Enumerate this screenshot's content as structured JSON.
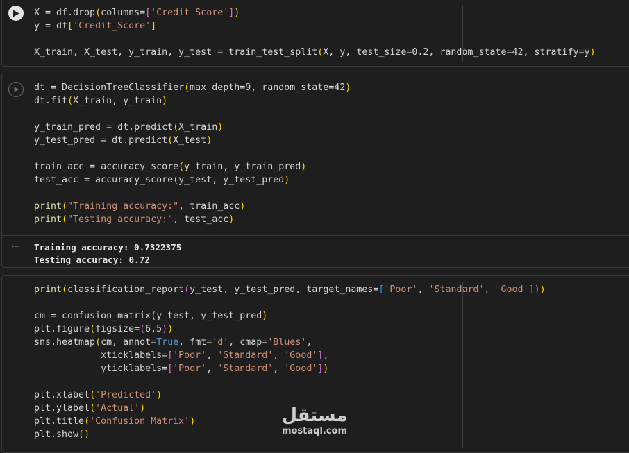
{
  "cells": [
    {
      "id": "cell1",
      "run_state": "active",
      "lines": [
        [
          {
            "t": "X = df.drop"
          },
          {
            "t": "(",
            "c": "br1"
          },
          {
            "t": "columns="
          },
          {
            "t": "[",
            "c": "br2"
          },
          {
            "t": "'Credit_Score'",
            "c": "str"
          },
          {
            "t": "]",
            "c": "br2"
          },
          {
            "t": ")",
            "c": "br1"
          }
        ],
        [
          {
            "t": "y = df"
          },
          {
            "t": "[",
            "c": "br1"
          },
          {
            "t": "'Credit_Score'",
            "c": "str"
          },
          {
            "t": "]",
            "c": "br1"
          }
        ],
        [],
        [
          {
            "t": "X_train, X_test, y_train, y_test = train_test_split"
          },
          {
            "t": "(",
            "c": "br1"
          },
          {
            "t": "X, y, test_size=0.2, random_state=42, stratify=y"
          },
          {
            "t": ")",
            "c": "br1"
          }
        ]
      ]
    },
    {
      "id": "cell2",
      "run_state": "inactive",
      "lines": [
        [
          {
            "t": "dt = DecisionTreeClassifier"
          },
          {
            "t": "(",
            "c": "br1"
          },
          {
            "t": "max_depth=9, random_state=42"
          },
          {
            "t": ")",
            "c": "br1"
          }
        ],
        [
          {
            "t": "dt.fit"
          },
          {
            "t": "(",
            "c": "br1"
          },
          {
            "t": "X_train, y_train"
          },
          {
            "t": ")",
            "c": "br1"
          }
        ],
        [],
        [
          {
            "t": "y_train_pred = dt.predict"
          },
          {
            "t": "(",
            "c": "br1"
          },
          {
            "t": "X_train"
          },
          {
            "t": ")",
            "c": "br1"
          }
        ],
        [
          {
            "t": "y_test_pred = dt.predict"
          },
          {
            "t": "(",
            "c": "br1"
          },
          {
            "t": "X_test"
          },
          {
            "t": ")",
            "c": "br1"
          }
        ],
        [],
        [
          {
            "t": "train_acc = accuracy_score"
          },
          {
            "t": "(",
            "c": "br1"
          },
          {
            "t": "y_train, y_train_pred"
          },
          {
            "t": ")",
            "c": "br1"
          }
        ],
        [
          {
            "t": "test_acc = accuracy_score"
          },
          {
            "t": "(",
            "c": "br1"
          },
          {
            "t": "y_test, y_test_pred"
          },
          {
            "t": ")",
            "c": "br1"
          }
        ],
        [],
        [
          {
            "t": "print",
            "c": "fn"
          },
          {
            "t": "(",
            "c": "br1"
          },
          {
            "t": "\"Training accuracy:\"",
            "c": "str"
          },
          {
            "t": ", train_acc"
          },
          {
            "t": ")",
            "c": "br1"
          }
        ],
        [
          {
            "t": "print",
            "c": "fn"
          },
          {
            "t": "(",
            "c": "br1"
          },
          {
            "t": "\"Testing accuracy:\"",
            "c": "str"
          },
          {
            "t": ", test_acc"
          },
          {
            "t": ")",
            "c": "br1"
          }
        ]
      ],
      "output": {
        "menu": "⋯",
        "lines": [
          "Training accuracy: 0.7322375",
          "Testing accuracy: 0.72"
        ]
      }
    },
    {
      "id": "cell3",
      "run_state": "none",
      "lines": [
        [
          {
            "t": "print",
            "c": "fn"
          },
          {
            "t": "(",
            "c": "br1"
          },
          {
            "t": "classification_report"
          },
          {
            "t": "(",
            "c": "br2"
          },
          {
            "t": "y_test, y_test_pred, target_names="
          },
          {
            "t": "[",
            "c": "br3"
          },
          {
            "t": "'Poor'",
            "c": "str"
          },
          {
            "t": ", "
          },
          {
            "t": "'Standard'",
            "c": "str"
          },
          {
            "t": ", "
          },
          {
            "t": "'Good'",
            "c": "str"
          },
          {
            "t": "]",
            "c": "br3"
          },
          {
            "t": ")",
            "c": "br2"
          },
          {
            "t": ")",
            "c": "br1"
          }
        ],
        [],
        [
          {
            "t": "cm = confusion_matrix"
          },
          {
            "t": "(",
            "c": "br1"
          },
          {
            "t": "y_test, y_test_pred"
          },
          {
            "t": ")",
            "c": "br1"
          }
        ],
        [
          {
            "t": "plt.figure"
          },
          {
            "t": "(",
            "c": "br1"
          },
          {
            "t": "figsize="
          },
          {
            "t": "(",
            "c": "br2"
          },
          {
            "t": "6,5"
          },
          {
            "t": ")",
            "c": "br2"
          },
          {
            "t": ")",
            "c": "br1"
          }
        ],
        [
          {
            "t": "sns.heatmap"
          },
          {
            "t": "(",
            "c": "br1"
          },
          {
            "t": "cm, annot="
          },
          {
            "t": "True",
            "c": "kw"
          },
          {
            "t": ", fmt="
          },
          {
            "t": "'d'",
            "c": "str"
          },
          {
            "t": ", cmap="
          },
          {
            "t": "'Blues'",
            "c": "str"
          },
          {
            "t": ","
          }
        ],
        [
          {
            "t": "            xticklabels="
          },
          {
            "t": "[",
            "c": "br2"
          },
          {
            "t": "'Poor'",
            "c": "str"
          },
          {
            "t": ", "
          },
          {
            "t": "'Standard'",
            "c": "str"
          },
          {
            "t": ", "
          },
          {
            "t": "'Good'",
            "c": "str"
          },
          {
            "t": "]",
            "c": "br2"
          },
          {
            "t": ","
          }
        ],
        [
          {
            "t": "            yticklabels="
          },
          {
            "t": "[",
            "c": "br2"
          },
          {
            "t": "'Poor'",
            "c": "str"
          },
          {
            "t": ", "
          },
          {
            "t": "'Standard'",
            "c": "str"
          },
          {
            "t": ", "
          },
          {
            "t": "'Good'",
            "c": "str"
          },
          {
            "t": "]",
            "c": "br2"
          },
          {
            "t": ")",
            "c": "br1"
          }
        ],
        [],
        [
          {
            "t": "plt.xlabel"
          },
          {
            "t": "(",
            "c": "br1"
          },
          {
            "t": "'Predicted'",
            "c": "str"
          },
          {
            "t": ")",
            "c": "br1"
          }
        ],
        [
          {
            "t": "plt.ylabel"
          },
          {
            "t": "(",
            "c": "br1"
          },
          {
            "t": "'Actual'",
            "c": "str"
          },
          {
            "t": ")",
            "c": "br1"
          }
        ],
        [
          {
            "t": "plt.title"
          },
          {
            "t": "(",
            "c": "br1"
          },
          {
            "t": "'Confusion Matrix'",
            "c": "str"
          },
          {
            "t": ")",
            "c": "br1"
          }
        ],
        [
          {
            "t": "plt.show"
          },
          {
            "t": "(",
            "c": "br1"
          },
          {
            "t": ")",
            "c": "br1"
          }
        ]
      ]
    }
  ],
  "watermark": {
    "logo_text": "مستقل",
    "domain": "mostaql.com"
  }
}
